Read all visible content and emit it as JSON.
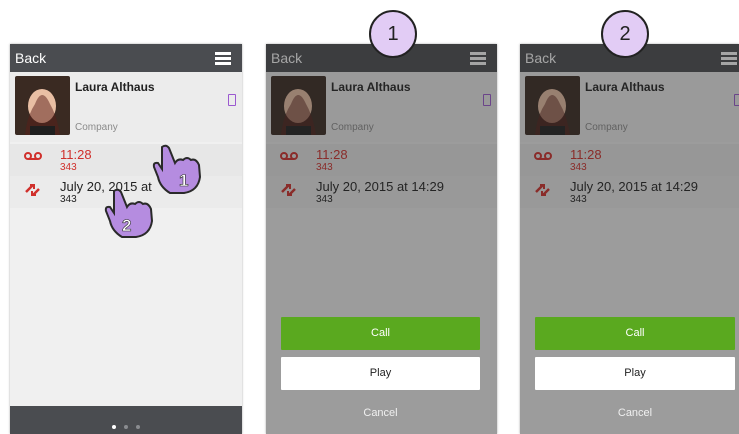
{
  "screens": [
    {
      "back": "Back",
      "name": "Laura Althaus",
      "company": "Company",
      "items": [
        {
          "time": "11:28",
          "number": "343"
        },
        {
          "time": "July 20, 2015 at",
          "number": "343"
        }
      ]
    },
    {
      "back": "Back",
      "name": "Laura Althaus",
      "company": "Company",
      "items": [
        {
          "time": "11:28",
          "number": "343"
        },
        {
          "time": "July 20, 2015 at 14:29",
          "number": "343"
        }
      ],
      "sheet": {
        "call": "Call",
        "play": "Play",
        "cancel": "Cancel"
      }
    },
    {
      "back": "Back",
      "name": "Laura Althaus",
      "company": "Company",
      "items": [
        {
          "time": "11:28",
          "number": "343"
        },
        {
          "time": "July 20, 2015 at 14:29",
          "number": "343"
        }
      ],
      "sheet": {
        "call": "Call",
        "play": "Play",
        "cancel": "Cancel"
      }
    }
  ],
  "steps": [
    "1",
    "2"
  ],
  "hands": [
    "1",
    "2"
  ],
  "pager": {
    "count": 3,
    "active": 0
  },
  "icons": {
    "menu": "hamburger-icon",
    "voicemail": "voicemail-icon",
    "call": "call-arrows-icon",
    "device": "mobile-device-icon",
    "hand": "pointing-hand-icon"
  },
  "colors": {
    "header": "#4a4c50",
    "voicemail_red": "#d0302c",
    "call_green": "#5aa91f",
    "device_purple": "#9b59d0",
    "step_circle": "#e2ccf5"
  }
}
